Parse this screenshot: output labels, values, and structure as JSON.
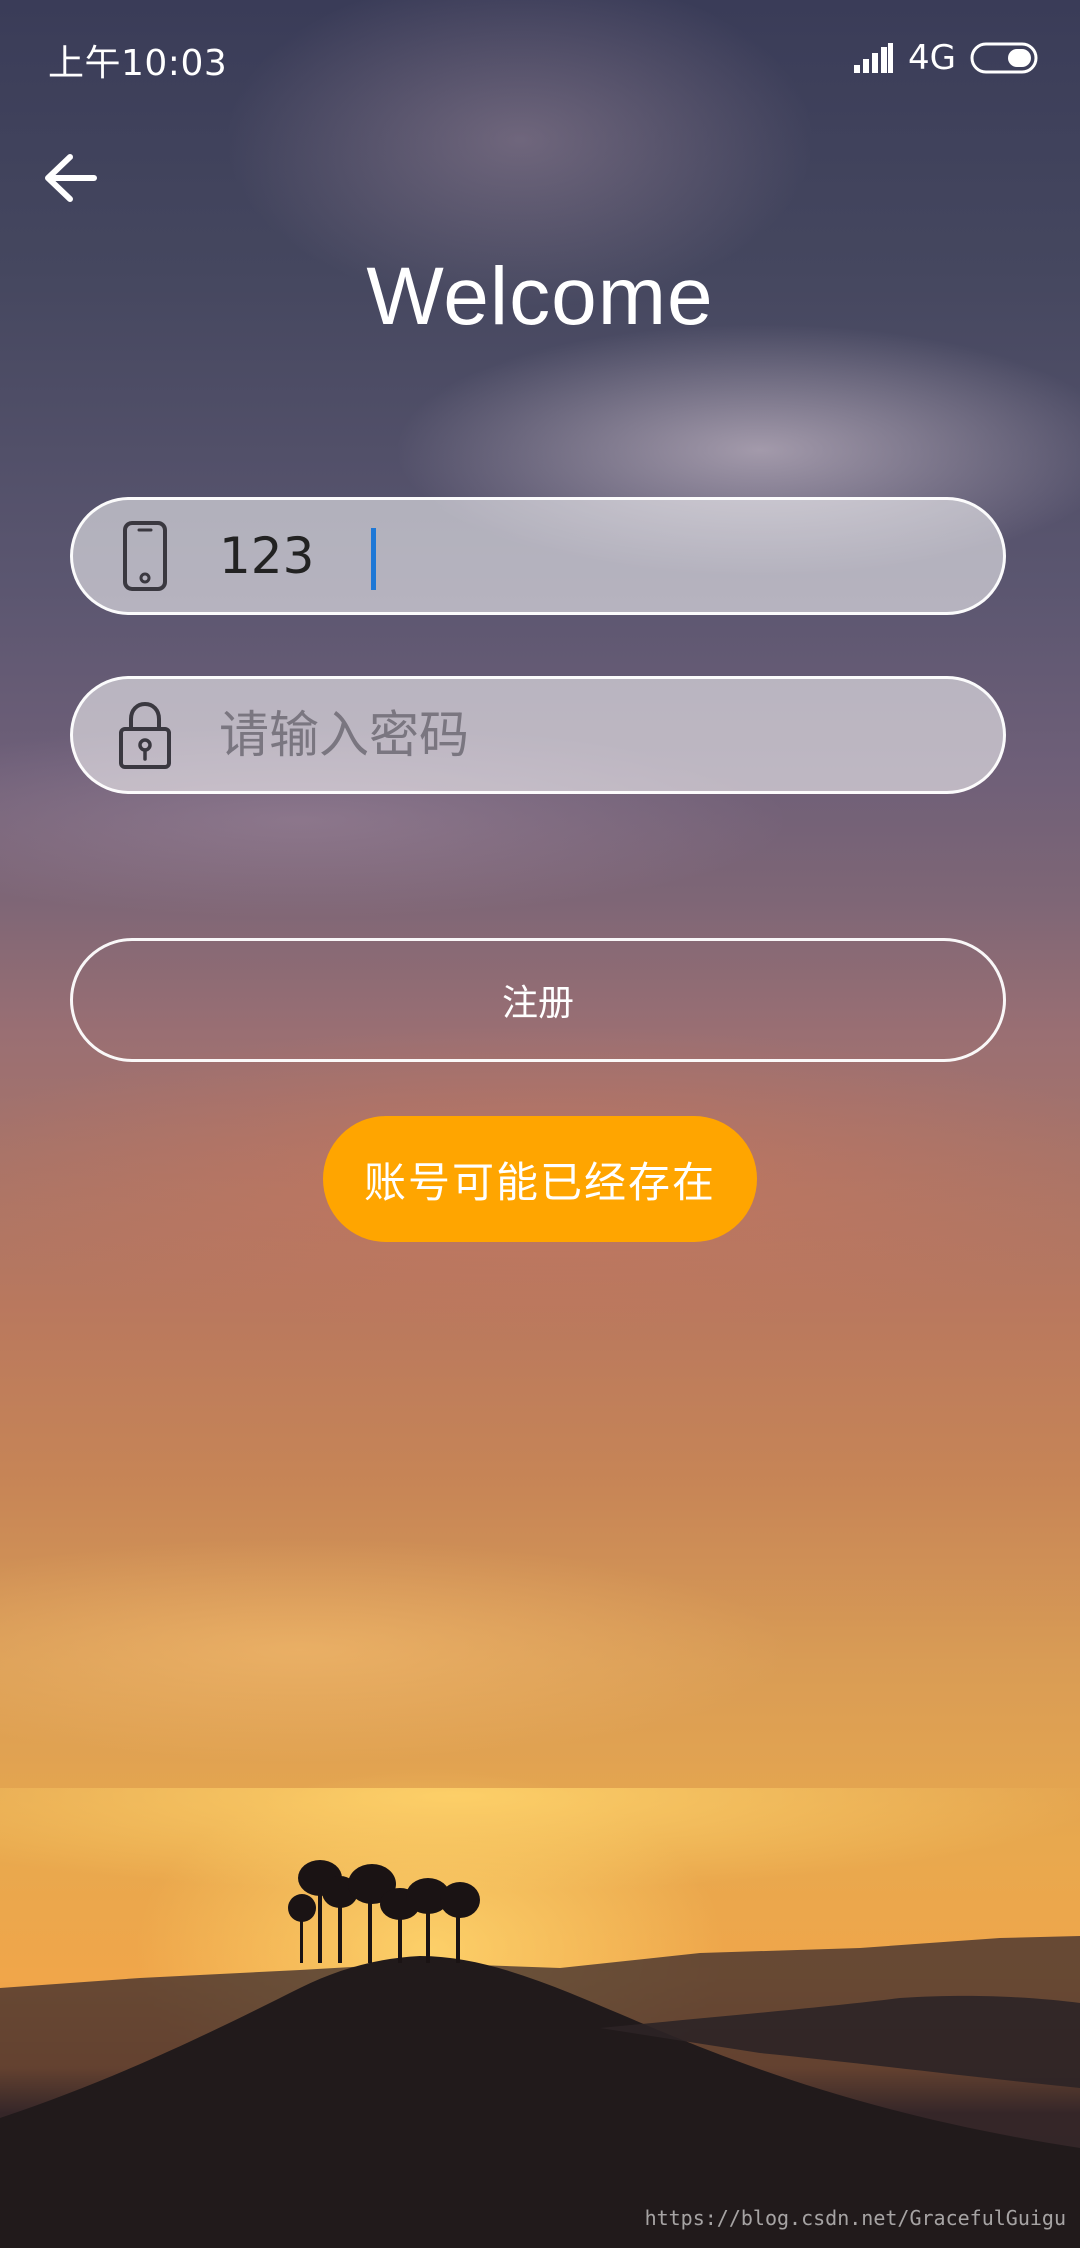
{
  "status_bar": {
    "time": "上午10:03",
    "network": "4G",
    "signal_icon": "signal-bars-icon",
    "battery_icon": "battery-icon"
  },
  "header": {
    "back_icon": "arrow-left-icon",
    "title": "Welcome"
  },
  "form": {
    "phone": {
      "icon": "phone-icon",
      "value": "123"
    },
    "password": {
      "icon": "lock-icon",
      "placeholder": "请输入密码",
      "value": ""
    },
    "register_label": "注册"
  },
  "toast": {
    "message": "账号可能已经存在",
    "color": "#ffa500"
  },
  "watermark": "https://blog.csdn.net/GracefulGuigu"
}
